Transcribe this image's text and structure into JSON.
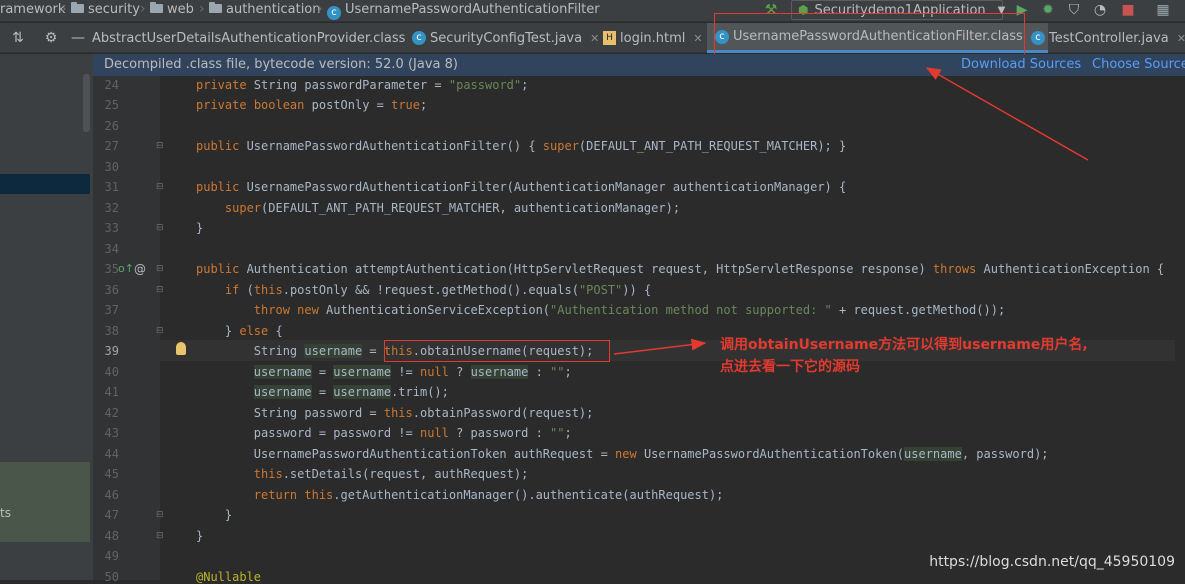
{
  "breadcrumbs": [
    "ramework",
    "security",
    "web",
    "authentication",
    "UsernamePasswordAuthenticationFilter"
  ],
  "run_config": "Securitydemo1Application",
  "tabs": [
    {
      "label": "AbstractUserDetailsAuthenticationProvider.class",
      "icon": "class-icon"
    },
    {
      "label": "SecurityConfigTest.java",
      "icon": "java-class-icon"
    },
    {
      "label": "login.html",
      "icon": "html-icon"
    },
    {
      "label": "UsernamePasswordAuthenticationFilter.class",
      "icon": "class-icon",
      "active": true
    },
    {
      "label": "TestController.java",
      "icon": "java-class-icon"
    }
  ],
  "banner": {
    "message": "Decompiled .class file, bytecode version: 52.0 (Java 8)",
    "download": "Download Sources",
    "choose": "Choose Sources..."
  },
  "lines": [
    {
      "n": "24"
    },
    {
      "n": "25"
    },
    {
      "n": "26"
    },
    {
      "n": "27"
    },
    {
      "n": "30"
    },
    {
      "n": "31"
    },
    {
      "n": "32"
    },
    {
      "n": "33"
    },
    {
      "n": "34"
    },
    {
      "n": "35"
    },
    {
      "n": "36"
    },
    {
      "n": "37"
    },
    {
      "n": "38"
    },
    {
      "n": "39"
    },
    {
      "n": "40"
    },
    {
      "n": "41"
    },
    {
      "n": "42"
    },
    {
      "n": "43"
    },
    {
      "n": "44"
    },
    {
      "n": "45"
    },
    {
      "n": "46"
    },
    {
      "n": "47"
    },
    {
      "n": "48"
    },
    {
      "n": "49"
    },
    {
      "n": "50"
    }
  ],
  "annotation": {
    "line1": "调用obtainUsername方法可以得到username用户名,",
    "line2": "点进去看一下它的源码"
  },
  "left_panel_fragment": "ts",
  "watermark": "https://blog.csdn.net/qq_45950109",
  "colors": {
    "accent": "#4a88c7",
    "annotation": "#e23a2f",
    "keyword": "#cc7832",
    "string": "#6a8759",
    "banner": "#31445e"
  }
}
